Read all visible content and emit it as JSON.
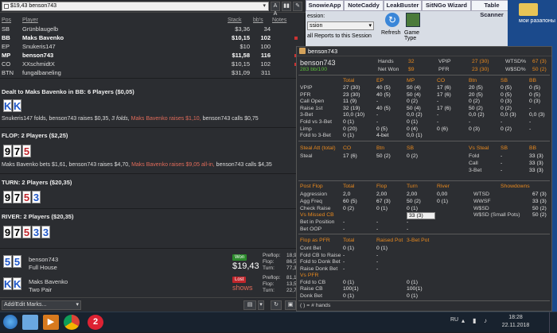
{
  "toolbar": {
    "hand_title": "$19,43 benson743",
    "btn_aa": "A A",
    "btn_bars": "▮▮"
  },
  "players": {
    "headers": [
      "Pos",
      "Player",
      "Stack",
      "bb's",
      "Notes"
    ],
    "rows": [
      {
        "pos": "SB",
        "name": "Grünblaugelb",
        "stack": "$3,36",
        "bbs": "34",
        "bold": false,
        "note": false
      },
      {
        "pos": "BB",
        "name": "Maks Bavenko",
        "stack": "$10,15",
        "bbs": "102",
        "bold": true,
        "note": true
      },
      {
        "pos": "EP",
        "name": "Snukeris147",
        "stack": "$10",
        "bbs": "100",
        "bold": false,
        "note": false
      },
      {
        "pos": "MP",
        "name": "benson743",
        "stack": "$11,58",
        "bbs": "116",
        "bold": true,
        "note": true
      },
      {
        "pos": "CO",
        "name": "XXschmidtX",
        "stack": "$10,15",
        "bbs": "102",
        "bold": false,
        "note": true
      },
      {
        "pos": "BTN",
        "name": "fungalbaneling",
        "stack": "$31,09",
        "bbs": "311",
        "bold": false,
        "note": false
      }
    ]
  },
  "streets": {
    "preflop": {
      "title": "Dealt to Maks Bavenko in BB: 6 Players ($0,05)",
      "cards": [
        "K",
        "K"
      ],
      "action_a": "Snukeris147 folds, benson743 raises $0,35, ",
      "action_i": "3 folds,",
      "action_r": " Maks Bavenko raises $1,10,",
      "action_b": " benson743 calls $0,75"
    },
    "flop": {
      "title": "FLOP: 2 Players ($2,25)",
      "cards": [
        "9",
        "7",
        "5"
      ],
      "action_a": "Maks Bavenko bets $1,61, benson743 raises $4,70, ",
      "action_r": "Maks Bavenko raises $9,05 all-in,",
      "action_b": " benson743 calls $4,35"
    },
    "turn": {
      "title": "TURN: 2 Players ($20,35)",
      "cards": [
        "9",
        "7",
        "5",
        "3"
      ]
    },
    "river": {
      "title": "RIVER: 2 Players ($20,35)",
      "cards": [
        "9",
        "7",
        "5",
        "3",
        "3"
      ]
    }
  },
  "results": [
    {
      "cards": [
        "5",
        "5"
      ],
      "name": "benson743",
      "hand": "Full House",
      "badge": "Won",
      "amount": "$19,43",
      "stats": [
        [
          "Preflop:",
          "18,9"
        ],
        [
          "Flop:",
          "86,5"
        ],
        [
          "Turn:",
          "77,3"
        ]
      ]
    },
    {
      "cards": [
        "K",
        "K"
      ],
      "name": "Maks Bavenko",
      "hand": "Two Pair",
      "badge": "Lost",
      "amount": "shows",
      "stats": [
        [
          "Preflop:",
          "81,1"
        ],
        [
          "Flop:",
          "13,5"
        ],
        [
          "Turn:",
          "22,7"
        ]
      ]
    }
  ],
  "bottom": {
    "add_edit": "Add/Edit Marks..."
  },
  "mid_app": {
    "tabs": [
      "SnowieApp",
      "NoteCaddy",
      "LeakBuster",
      "SitNGo Wizard",
      "Table Scanner"
    ],
    "session_label": "ession:",
    "session_value": "ssion",
    "reports_text": "all Reports to this Session",
    "refresh": "Refresh",
    "game_type": "Game Type"
  },
  "hud": {
    "title": "benson743",
    "name": "benson743",
    "winrate": "283 bb/100",
    "hands_label": "Hands",
    "hands_value": "32",
    "net_label": "Net Won",
    "net_value": "$9",
    "vpip_label": "VPIP",
    "vpip_value": "27 (30)",
    "pfr_label": "PFR",
    "pfr_value": "23 (30)",
    "wtsd_label": "WTSD%",
    "wtsd_value": "67 (3)",
    "wsd_label": "W$SD%",
    "wsd_value": "50 (2)",
    "pos_headers": [
      "Total",
      "EP",
      "MP",
      "CO",
      "Btn",
      "SB",
      "BB"
    ],
    "pos_rows": [
      {
        "label": "VPIP",
        "vals": [
          "27 (30)",
          "40 (5)",
          "50 (4)",
          "17 (6)",
          "20 (5)",
          "0 (5)",
          "0 (5)"
        ]
      },
      {
        "label": "PFR",
        "vals": [
          "23 (30)",
          "40 (5)",
          "50 (4)",
          "17 (6)",
          "20 (5)",
          "0 (5)",
          "0 (5)"
        ]
      },
      {
        "label": "Call Open",
        "vals": [
          "11 (9)",
          "-",
          "0 (2)",
          "-",
          "0 (2)",
          "0 (3)",
          "0 (3)"
        ]
      },
      {
        "label": "Raise 1st",
        "vals": [
          "32 (19)",
          "40 (5)",
          "50 (4)",
          "17 (6)",
          "50 (2)",
          "0 (2)",
          "-"
        ]
      },
      {
        "label": "3-Bet",
        "vals": [
          "10,0 (10)",
          "-",
          "0,0 (2)",
          "-",
          "0,0 (2)",
          "0,0 (3)",
          "0,0 (3)"
        ]
      },
      {
        "label": "Fold vs 3-Bet",
        "vals": [
          "0 (1)",
          "-",
          "0 (1)",
          "-",
          "-",
          "-",
          "-"
        ]
      },
      {
        "label": "Limp",
        "vals": [
          "0 (20)",
          "0 (5)",
          "0 (4)",
          "0 (6)",
          "0 (3)",
          "0 (2)",
          "-"
        ]
      },
      {
        "label": "Fold to 3-Bet",
        "vals": [
          "0 (1)",
          "4-bet",
          "0,0 (1)",
          "",
          "",
          "",
          ""
        ]
      }
    ],
    "steal": {
      "headers": [
        "Steal Att (total)",
        "CO",
        "Btn",
        "SB",
        "Vs Steal",
        "SB",
        "BB"
      ],
      "row_label": "Steal",
      "row_vals": [
        "17 (6)",
        "50 (2)",
        "0 (2)"
      ],
      "vs_rows": [
        [
          "Fold",
          "-",
          "33 (3)"
        ],
        [
          "Call",
          "-",
          "33 (3)"
        ],
        [
          "3-Bet",
          "-",
          "33 (3)"
        ]
      ]
    },
    "postflop": {
      "headers": [
        "Post Flop",
        "Total",
        "Flop",
        "Turn",
        "River",
        "Showdowns"
      ],
      "rows": [
        {
          "label": "Aggression",
          "vals": [
            "2,0",
            "2,00",
            "2,00",
            "0,00"
          ]
        },
        {
          "label": "Agg Freq",
          "vals": [
            "60 (5)",
            "67 (3)",
            "50 (2)",
            "0 (1)"
          ]
        },
        {
          "label": "Check Raise",
          "vals": [
            "0 (2)",
            "0 (1)",
            "0 (1)",
            ""
          ]
        },
        {
          "label": "Vs Missed CB",
          "vals": [
            "",
            "",
            "33 (3)",
            ""
          ]
        },
        {
          "label": "Bet in Position",
          "vals": [
            "-",
            "-",
            "-",
            ""
          ]
        },
        {
          "label": "Bet OOP",
          "vals": [
            "-",
            "-",
            "-",
            ""
          ]
        }
      ],
      "show_rows": [
        [
          "WTSD",
          "67 (3)"
        ],
        [
          "WWSF",
          "33 (3)"
        ],
        [
          "W$SD",
          "50 (2)"
        ],
        [
          "W$SD (Small Pots)",
          "50 (2)"
        ]
      ]
    },
    "pfr": {
      "headers": [
        "Flop as PFR",
        "Total",
        "Raised Pot",
        "3-Bet Pot"
      ],
      "rows": [
        {
          "label": "Cont Bet",
          "vals": [
            "0 (1)",
            "0 (1)",
            "",
            ""
          ]
        },
        {
          "label": "Fold CB to Raise",
          "vals": [
            "-",
            "-",
            "",
            ""
          ]
        },
        {
          "label": "Fold to Donk Bet",
          "vals": [
            "-",
            "-",
            "",
            ""
          ]
        },
        {
          "label": "Raise Donk Bet",
          "vals": [
            "-",
            "-",
            "",
            ""
          ]
        },
        {
          "label": "Vs PFR",
          "vals": [
            "",
            "",
            "",
            ""
          ]
        },
        {
          "label": "Fold to CB",
          "vals": [
            "0 (1)",
            "",
            "0 (1)",
            ""
          ]
        },
        {
          "label": "Raise CB",
          "vals": [
            "100(1)",
            "",
            "100(1)",
            ""
          ]
        },
        {
          "label": "Donk Bet",
          "vals": [
            "0 (1)",
            "",
            "0 (1)",
            ""
          ]
        }
      ]
    },
    "footer": "( ) = # hands"
  },
  "desktop": {
    "folder_label": "мои разапоны"
  },
  "taskbar": {
    "lang": "RU",
    "time": "18:28",
    "date": "22.11.2018"
  },
  "colors": {
    "orange": "#e8891e",
    "green": "#5bbf3a",
    "red_text": "#e06b5a",
    "blue_card": "#1f57c8",
    "red_card": "#c0262c"
  }
}
